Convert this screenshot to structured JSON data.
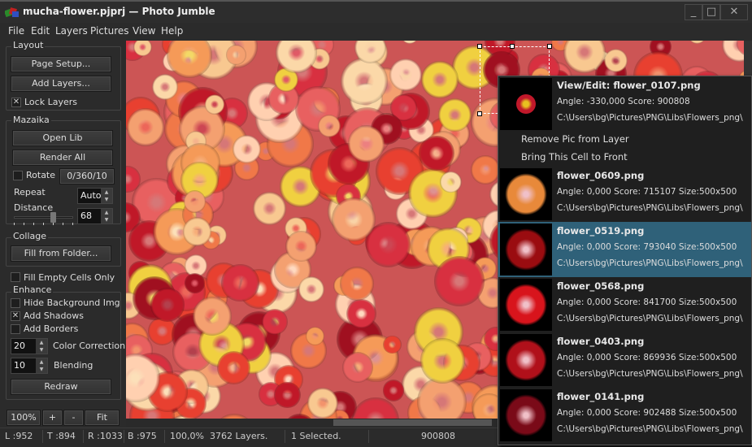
{
  "window": {
    "title": "mucha-flower.pjprj  —  Photo Jumble",
    "minimize": "_",
    "maximize": "□",
    "close": "✕"
  },
  "menu": [
    "File",
    "Edit",
    "Layers",
    "Pictures",
    "View",
    "Help"
  ],
  "layout": {
    "label": "Layout",
    "page_setup": "Page Setup...",
    "add_layers": "Add Layers...",
    "lock_layers": "Lock Layers",
    "lock_checked": true
  },
  "mazaika": {
    "label": "Mazaika",
    "open_lib": "Open Lib",
    "render_all": "Render All",
    "rotate": "Rotate",
    "rotate_checked": false,
    "rotate_value": "0/360/10",
    "repeat": "Repeat",
    "repeat_value": "Auto",
    "distance": "Distance",
    "distance_value": "68"
  },
  "collage": {
    "label": "Collage",
    "fill_from_folder": "Fill from Folder...",
    "fill_empty": "Fill Empty Cells Only",
    "fill_empty_checked": false
  },
  "enhance": {
    "label": "Enhance",
    "hide_bg": "Hide Background Img",
    "hide_bg_checked": false,
    "add_shadows": "Add Shadows",
    "add_shadows_checked": true,
    "add_borders": "Add Borders",
    "add_borders_checked": false,
    "color_correction_value": "20",
    "color_correction": "Color Correction",
    "blending_value": "10",
    "blending": "Blending",
    "redraw": "Redraw"
  },
  "zoom": {
    "z100": "100%",
    "plus": "+",
    "minus": "-",
    "fit": "Fit"
  },
  "status": {
    "l": "L :952",
    "t": "T :894",
    "r": "R :1033",
    "b": "B :975",
    "zoom": "100,0%",
    "layers": "3762 Layers.",
    "selected": "1 Selected.",
    "score": "900808"
  },
  "popup": {
    "current": {
      "title": "View/Edit: flower_0107.png",
      "info": "Angle: -330,000  Score: 900808",
      "path": "C:\\Users\\bg\\Pictures\\PNG\\Libs\\Flowers_png\\",
      "color": "#c0182a"
    },
    "actions": [
      "Remove Pic from Layer",
      "Bring This Cell to Front"
    ],
    "items": [
      {
        "name": "flower_0609.png",
        "info": "Angle: 0,000  Score: 715107  Size:500x500",
        "path": "C:\\Users\\bg\\Pictures\\PNG\\Libs\\Flowers_png\\",
        "color": "#e8893a",
        "selected": false
      },
      {
        "name": "flower_0519.png",
        "info": "Angle: 0,000  Score: 793040  Size:500x500",
        "path": "C:\\Users\\bg\\Pictures\\PNG\\Libs\\Flowers_png\\",
        "color": "#9a0c10",
        "selected": true
      },
      {
        "name": "flower_0568.png",
        "info": "Angle: 0,000  Score: 841700  Size:500x500",
        "path": "C:\\Users\\bg\\Pictures\\PNG\\Libs\\Flowers_png\\",
        "color": "#d8141c",
        "selected": false
      },
      {
        "name": "flower_0403.png",
        "info": "Angle: 0,000  Score: 869936  Size:500x500",
        "path": "C:\\Users\\bg\\Pictures\\PNG\\Libs\\Flowers_png\\",
        "color": "#b0101a",
        "selected": false
      },
      {
        "name": "flower_0141.png",
        "info": "Angle: 0,000  Score: 902488  Size:500x500",
        "path": "C:\\Users\\bg\\Pictures\\PNG\\Libs\\Flowers_png\\",
        "color": "#7a0a18",
        "selected": false
      }
    ]
  },
  "colors": {
    "selection": "#2f6179",
    "background": "#2b2b2b"
  }
}
